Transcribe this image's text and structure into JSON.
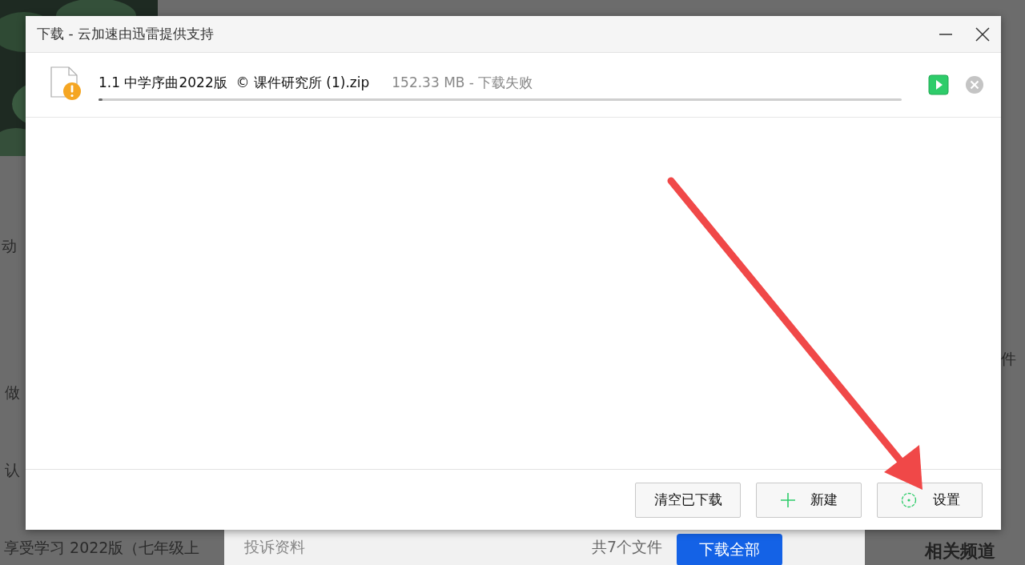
{
  "background_page": {
    "side_texts": [
      "动",
      "做",
      "认"
    ],
    "course_title": "享受学习 2022版（七年级上",
    "right_text": "件",
    "footer": {
      "report_link": "投诉资料",
      "file_count": "共7个文件",
      "download_all_button": "下载全部"
    },
    "related_heading": "相关频道"
  },
  "dialog": {
    "title": "下载 - 云加速由迅雷提供支持",
    "downloads": [
      {
        "name": "1.1 中学序曲2022版  © 课件研究所 (1).zip",
        "info": "152.33 MB - 下载失败",
        "failed": true,
        "level": 0.005
      }
    ],
    "buttons": [
      {
        "label": "清空已下载",
        "kind": "plain"
      },
      {
        "label": "新建",
        "kind": "new"
      },
      {
        "label": "设置",
        "kind": "settings"
      }
    ]
  }
}
